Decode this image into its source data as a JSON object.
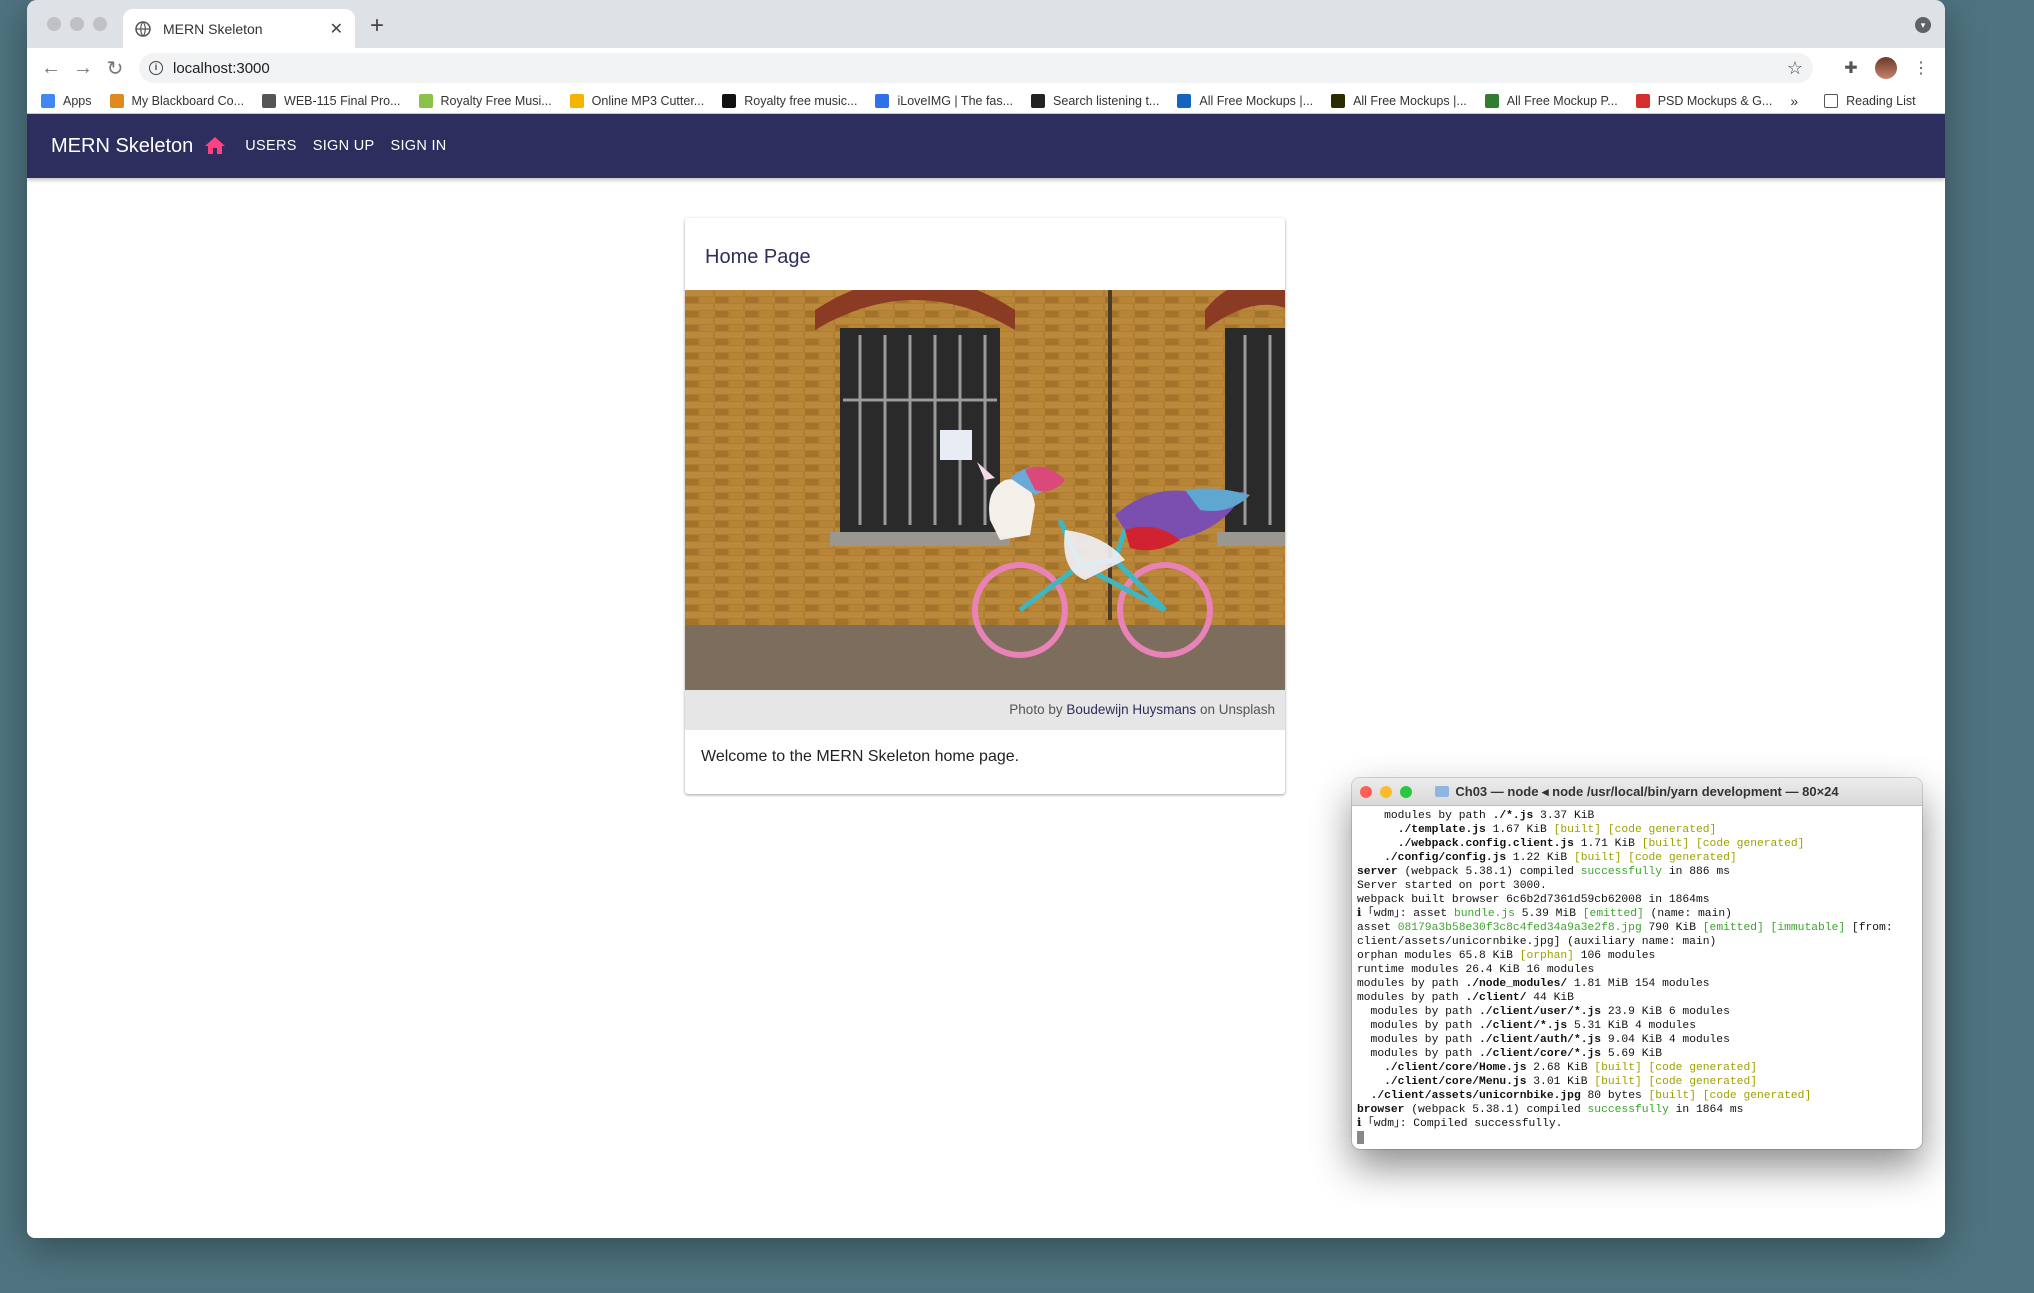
{
  "browser": {
    "tab_title": "MERN Skeleton",
    "url": "localhost:3000",
    "bookmarks": [
      {
        "label": "Apps",
        "color": "#4285f4"
      },
      {
        "label": "My Blackboard Co...",
        "color": "#e08a1e"
      },
      {
        "label": "WEB-115 Final Pro...",
        "color": "#555555"
      },
      {
        "label": "Royalty Free Musi...",
        "color": "#8bc34a"
      },
      {
        "label": "Online MP3 Cutter...",
        "color": "#f4b400"
      },
      {
        "label": "Royalty free music...",
        "color": "#111111"
      },
      {
        "label": "iLoveIMG | The fas...",
        "color": "#2f6fe8"
      },
      {
        "label": "Search listening t...",
        "color": "#222222"
      },
      {
        "label": "All Free Mockups |...",
        "color": "#1565c0"
      },
      {
        "label": "All Free Mockups |...",
        "color": "#2b2b00"
      },
      {
        "label": "All Free Mockup P...",
        "color": "#2e7d32"
      },
      {
        "label": "PSD Mockups & G...",
        "color": "#d32f2f"
      }
    ],
    "more_label": "»",
    "reading_list": "Reading List"
  },
  "app": {
    "brand": "MERN Skeleton",
    "nav": [
      "USERS",
      "SIGN UP",
      "SIGN IN"
    ],
    "accent": "#ff4081",
    "primary": "#2d2e5d"
  },
  "card": {
    "title": "Home Page",
    "caption_prefix": "Photo by",
    "caption_author": "Boudewijn Huysmans",
    "caption_suffix": "on Unsplash",
    "body": "Welcome to the MERN Skeleton home page."
  },
  "terminal": {
    "title": "Ch03 — node ◂ node /usr/local/bin/yarn development — 80×24",
    "lines": [
      [
        {
          "t": "    modules by path "
        },
        {
          "t": "./*.js",
          "c": "b"
        },
        {
          "t": " 3.37 KiB"
        }
      ],
      [
        {
          "t": "      "
        },
        {
          "t": "./template.js",
          "c": "b"
        },
        {
          "t": " 1.67 KiB "
        },
        {
          "t": "[built] [code generated]",
          "c": "y"
        }
      ],
      [
        {
          "t": "      "
        },
        {
          "t": "./webpack.config.client.js",
          "c": "b"
        },
        {
          "t": " 1.71 KiB "
        },
        {
          "t": "[built] [code generated]",
          "c": "y"
        }
      ],
      [
        {
          "t": "    "
        },
        {
          "t": "./config/config.js",
          "c": "b"
        },
        {
          "t": " 1.22 KiB "
        },
        {
          "t": "[built] [code generated]",
          "c": "y"
        }
      ],
      [
        {
          "t": "server",
          "c": "b"
        },
        {
          "t": " (webpack 5.38.1) compiled "
        },
        {
          "t": "successfully",
          "c": "g"
        },
        {
          "t": " in 886 ms"
        }
      ],
      [
        {
          "t": "Server started on port 3000."
        }
      ],
      [
        {
          "t": "webpack built browser 6c6b2d7361d59cb62008 in 1864ms"
        }
      ],
      [
        {
          "t": "ℹ ｢wdm｣: asset "
        },
        {
          "t": "bundle.js",
          "c": "g"
        },
        {
          "t": " 5.39 MiB "
        },
        {
          "t": "[emitted]",
          "c": "g"
        },
        {
          "t": " (name: main)"
        }
      ],
      [
        {
          "t": "asset "
        },
        {
          "t": "08179a3b58e30f3c8c4fed34a9a3e2f8.jpg",
          "c": "g"
        },
        {
          "t": " 790 KiB "
        },
        {
          "t": "[emitted] [immutable]",
          "c": "g"
        },
        {
          "t": " [from:"
        }
      ],
      [
        {
          "t": "client/assets/unicornbike.jpg] (auxiliary name: main)"
        }
      ],
      [
        {
          "t": "orphan modules 65.8 KiB "
        },
        {
          "t": "[orphan]",
          "c": "y"
        },
        {
          "t": " 106 modules"
        }
      ],
      [
        {
          "t": "runtime modules 26.4 KiB 16 modules"
        }
      ],
      [
        {
          "t": "modules by path "
        },
        {
          "t": "./node_modules/",
          "c": "b"
        },
        {
          "t": " 1.81 MiB 154 modules"
        }
      ],
      [
        {
          "t": "modules by path "
        },
        {
          "t": "./client/",
          "c": "b"
        },
        {
          "t": " 44 KiB"
        }
      ],
      [
        {
          "t": "  modules by path "
        },
        {
          "t": "./client/user/*.js",
          "c": "b"
        },
        {
          "t": " 23.9 KiB 6 modules"
        }
      ],
      [
        {
          "t": "  modules by path "
        },
        {
          "t": "./client/*.js",
          "c": "b"
        },
        {
          "t": " 5.31 KiB 4 modules"
        }
      ],
      [
        {
          "t": "  modules by path "
        },
        {
          "t": "./client/auth/*.js",
          "c": "b"
        },
        {
          "t": " 9.04 KiB 4 modules"
        }
      ],
      [
        {
          "t": "  modules by path "
        },
        {
          "t": "./client/core/*.js",
          "c": "b"
        },
        {
          "t": " 5.69 KiB"
        }
      ],
      [
        {
          "t": "    "
        },
        {
          "t": "./client/core/Home.js",
          "c": "b"
        },
        {
          "t": " 2.68 KiB "
        },
        {
          "t": "[built] [code generated]",
          "c": "y"
        }
      ],
      [
        {
          "t": "    "
        },
        {
          "t": "./client/core/Menu.js",
          "c": "b"
        },
        {
          "t": " 3.01 KiB "
        },
        {
          "t": "[built] [code generated]",
          "c": "y"
        }
      ],
      [
        {
          "t": "  "
        },
        {
          "t": "./client/assets/unicornbike.jpg",
          "c": "b"
        },
        {
          "t": " 80 bytes "
        },
        {
          "t": "[built] [code generated]",
          "c": "y"
        }
      ],
      [
        {
          "t": "browser",
          "c": "b"
        },
        {
          "t": " (webpack 5.38.1) compiled "
        },
        {
          "t": "successfully",
          "c": "g"
        },
        {
          "t": " in 1864 ms"
        }
      ],
      [
        {
          "t": "ℹ ｢wdm｣: Compiled successfully."
        }
      ]
    ]
  }
}
